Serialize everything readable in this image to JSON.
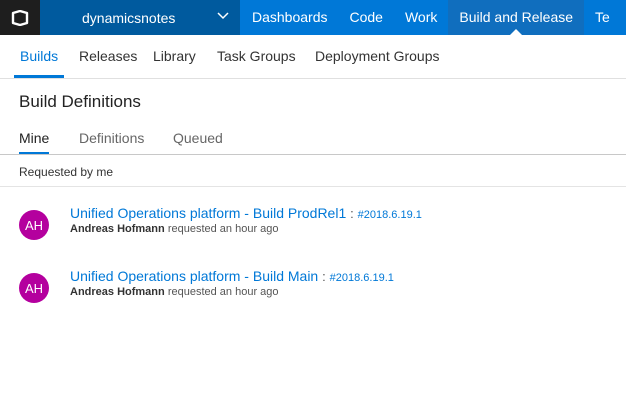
{
  "header": {
    "account": "dynamicsnotes",
    "nav": [
      "Dashboards",
      "Code",
      "Work",
      "Build and Release",
      "Te"
    ]
  },
  "subnav": [
    "Builds",
    "Releases",
    "Library",
    "Task Groups",
    "Deployment Groups"
  ],
  "page": {
    "title": "Build Definitions",
    "tabs": [
      "Mine",
      "Definitions",
      "Queued"
    ],
    "group_label": "Requested by me"
  },
  "builds": [
    {
      "avatar": "AH",
      "name": "Unified Operations platform - Build ProdRel1",
      "sep": ":",
      "number": "#2018.6.19.1",
      "user": "Andreas Hofmann",
      "status": "requested an hour ago"
    },
    {
      "avatar": "AH",
      "name": "Unified Operations platform - Build Main",
      "sep": ":",
      "number": "#2018.6.19.1",
      "user": "Andreas Hofmann",
      "status": "requested an hour ago"
    }
  ],
  "colors": {
    "brand": "#0078d7",
    "logo_bg": "#1e1e1e",
    "account_bg": "#005a9e",
    "avatar": "#b4009e"
  },
  "icons": {
    "logo": "vsts-logo-icon",
    "account_menu": "chevron-down-icon"
  }
}
